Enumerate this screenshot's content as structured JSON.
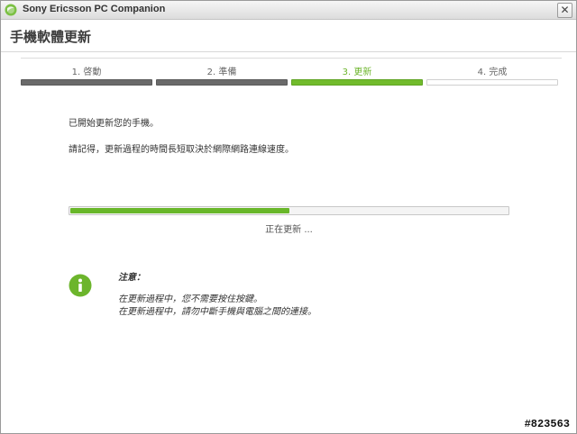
{
  "window": {
    "title": "Sony Ericsson PC Companion",
    "close_glyph": "✕"
  },
  "page": {
    "heading": "手機軟體更新"
  },
  "steps": [
    {
      "label": "1. 啓動",
      "state": "done"
    },
    {
      "label": "2. 準備",
      "state": "done"
    },
    {
      "label": "3. 更新",
      "state": "active"
    },
    {
      "label": "4. 完成",
      "state": "pending"
    }
  ],
  "messages": {
    "line1": "已開始更新您的手機。",
    "line2": "請記得，更新過程的時間長短取決於網際網路連線速度。"
  },
  "progress": {
    "fraction": 0.5,
    "status": "正在更新 ..."
  },
  "note": {
    "icon": "info-icon",
    "title": "注意：",
    "line1": "在更新過程中，您不需要按住按鍵。",
    "line2": "在更新過程中，請勿中斷手機與電腦之間的連接。"
  },
  "watermark": "#823563",
  "colors": {
    "accent_green": "#6cb52c",
    "done_gray": "#6a6a6a"
  }
}
